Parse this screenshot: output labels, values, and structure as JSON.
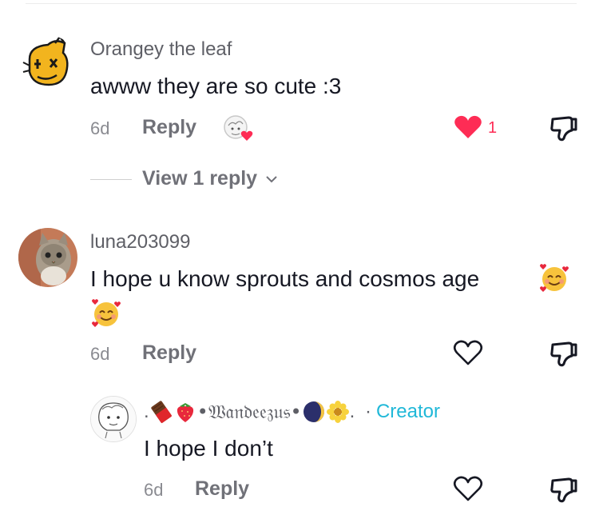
{
  "colors": {
    "like_red": "#fe2c55",
    "creator_blue": "#20b8d8",
    "meta_gray": "#707178",
    "name_gray": "#5e5f66"
  },
  "comments": [
    {
      "username": "Orangey the leaf",
      "text": "awww they are so cute :3",
      "time": "6d",
      "reply_label": "Reply",
      "like_count": "1",
      "liked": true,
      "avatar_icon": "orange-leaf-avatar",
      "view_replies": "View 1 reply"
    },
    {
      "username": "luna203099",
      "text_line1": "I hope u know sprouts and cosmos age",
      "emoji": "smiling-face-with-hearts",
      "time": "6d",
      "reply_label": "Reply",
      "liked": false,
      "avatar_icon": "kitten-photo-avatar"
    }
  ],
  "replies": [
    {
      "username_prefix": ".",
      "username_core": "•𝔚𝔞𝔫𝔡𝔢𝔢𝔷𝔲𝔰•",
      "username_suffix": ". ",
      "username_icons": [
        "chocolate-icon",
        "strawberry-icon",
        "moon-icon",
        "flower-icon"
      ],
      "badge_sep": "·",
      "badge": "Creator",
      "text": "I hope I don’t",
      "time": "6d",
      "reply_label": "Reply",
      "liked": false,
      "avatar_icon": "sketch-avatar"
    }
  ]
}
